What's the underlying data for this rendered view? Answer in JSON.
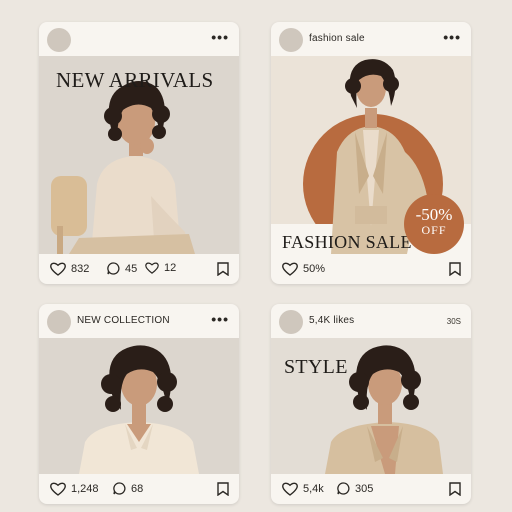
{
  "posts": [
    {
      "handle": "",
      "title": "NEW ARRIVALS",
      "likes": "832",
      "comments": "45",
      "shares": "12"
    },
    {
      "handle": "fashion sale",
      "title": "FASHION SALE",
      "badge_pct": "-50%",
      "badge_off": "OFF",
      "likes": "50%"
    },
    {
      "handle": "NEW COLLECTION",
      "likes": "1,248",
      "comments": "68"
    },
    {
      "handle": "5,4K likes",
      "time": "30S",
      "title": "STYLE",
      "likes": "5,4k",
      "comments": "305"
    }
  ],
  "icons": {
    "more": "more-dots-icon",
    "like": "heart-icon",
    "comment": "comment-bubble-icon",
    "save": "bookmark-icon"
  },
  "colors": {
    "background": "#ece7e0",
    "card": "#f8f5f0",
    "accent_terracotta": "#b86b3f",
    "beige": "#d8c3a5"
  }
}
